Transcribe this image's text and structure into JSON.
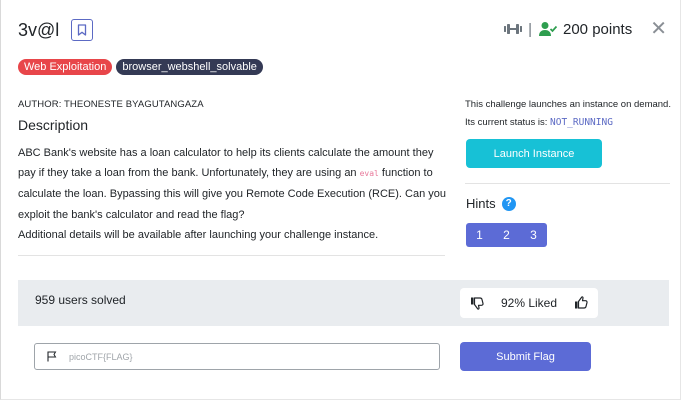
{
  "challenge": {
    "title": "3v@l",
    "points_label": "200 points",
    "separator": "|"
  },
  "tags": [
    {
      "label": "Web Exploitation",
      "color": "#e8464a"
    },
    {
      "label": "browser_webshell_solvable",
      "color": "#343a55"
    }
  ],
  "author": "AUTHOR: THEONESTE BYAGUTANGAZA",
  "description": {
    "heading": "Description",
    "part1": "ABC Bank's website has a loan calculator to help its clients calculate the amount they pay if they take a loan from the bank. Unfortunately, they are using an ",
    "code": "eval",
    "part2": " function to calculate the loan. Bypassing this will give you Remote Code Execution (RCE). Can you exploit the bank's calculator and read the flag?",
    "additional": "Additional details will be available after launching your challenge instance."
  },
  "instance": {
    "launch_note": "This challenge launches an instance on demand.",
    "status_prefix": "Its current status is: ",
    "status_value": "NOT_RUNNING",
    "launch_button": "Launch Instance"
  },
  "hints": {
    "label": "Hints",
    "help_glyph": "?",
    "items": [
      "1",
      "2",
      "3"
    ]
  },
  "stats": {
    "solved": "959 users solved",
    "liked": "92% Liked"
  },
  "flag": {
    "placeholder": "picoCTF{FLAG}",
    "value": "",
    "submit_label": "Submit Flag"
  },
  "close_glyph": "✕",
  "colors": {
    "accent": "#5c6bd6",
    "launch": "#17c1d6",
    "green_user": "#2e9e4f",
    "hint_help": "#2196f3"
  }
}
